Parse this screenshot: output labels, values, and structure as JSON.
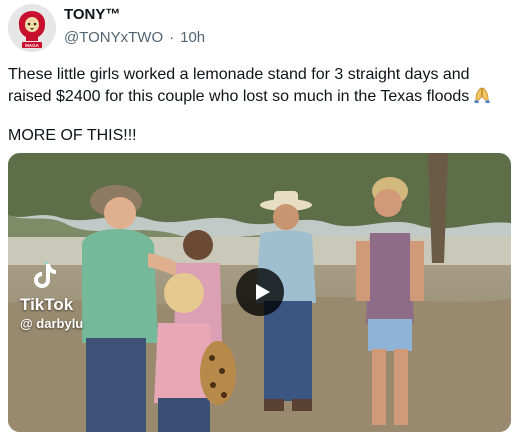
{
  "author": {
    "display_name": "TONY™",
    "handle": "@TONYxTWO",
    "separator": "·",
    "timestamp": "10h",
    "avatar_text": "MAGA"
  },
  "tweet": {
    "line1": "These little girls worked a lemonade stand for 3 straight days and raised $2400 for this couple who lost so much in the Texas floods",
    "emoji": "folded-hands-emoji",
    "line2": "MORE OF THIS!!!"
  },
  "media": {
    "watermark_brand": "TikTok",
    "watermark_user": "@ darbylu",
    "play_icon": "play-icon"
  },
  "colors": {
    "text": "#0f1419",
    "secondary": "#536471",
    "avatar_red": "#c8102e",
    "play_bg": "#000000"
  }
}
